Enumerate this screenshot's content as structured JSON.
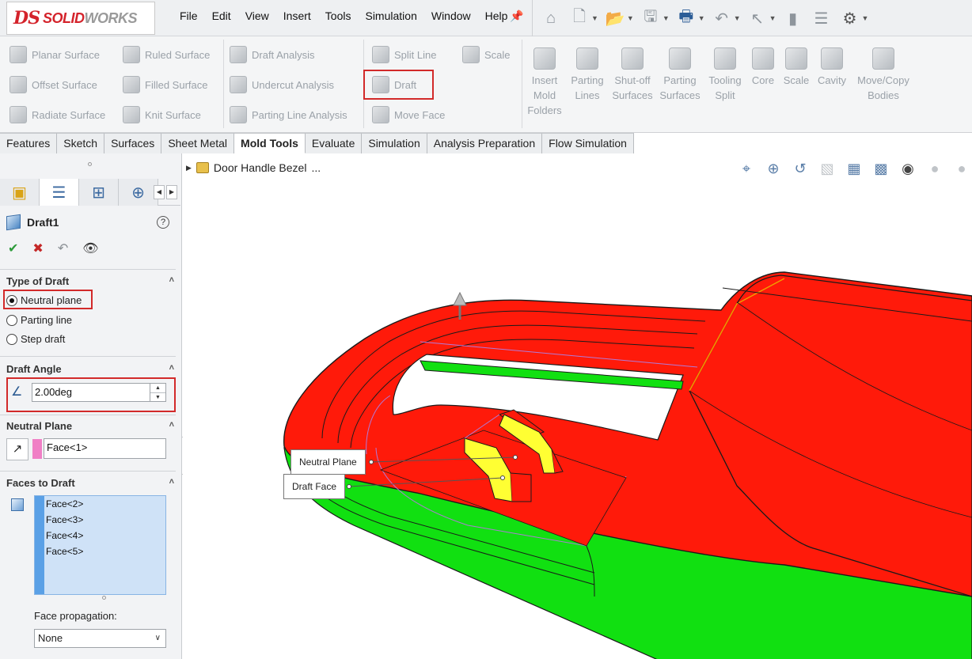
{
  "app": {
    "logo_mark": "DS",
    "logo_name_a": "SOLID",
    "logo_name_b": "WORKS",
    "menus": [
      "File",
      "Edit",
      "View",
      "Insert",
      "Tools",
      "Simulation",
      "Window",
      "Help"
    ]
  },
  "quick_icons": [
    "home-icon",
    "new-document-icon",
    "open-folder-icon",
    "save-icon",
    "print-icon",
    "undo-icon",
    "select-pointer-icon",
    "rebuild-icon",
    "file-properties-icon",
    "options-gear-icon"
  ],
  "ribbon": {
    "surfaces_col1": [
      "Planar Surface",
      "Offset Surface",
      "Radiate Surface"
    ],
    "surfaces_col2": [
      "Ruled Surface",
      "Filled Surface",
      "Knit Surface"
    ],
    "analysis": [
      "Draft Analysis",
      "Undercut Analysis",
      "Parting Line Analysis"
    ],
    "faces_col1": [
      "Split Line",
      "Draft",
      "Move Face"
    ],
    "scale": "Scale",
    "tooling": [
      [
        "Insert",
        "Mold",
        "Folders"
      ],
      [
        "Parting",
        "Lines"
      ],
      [
        "Shut-off",
        "Surfaces"
      ],
      [
        "Parting",
        "Surfaces"
      ],
      [
        "Tooling",
        "Split"
      ],
      [
        "Core"
      ],
      [
        "Scale"
      ],
      [
        "Cavity"
      ],
      [
        "Move/Copy",
        "Bodies"
      ]
    ]
  },
  "tabs": [
    "Features",
    "Sketch",
    "Surfaces",
    "Sheet Metal",
    "Mold Tools",
    "Evaluate",
    "Simulation",
    "Analysis Preparation",
    "Flow Simulation"
  ],
  "active_tab": "Mold Tools",
  "property_manager": {
    "title": "Draft1",
    "help": "?",
    "type_of_draft": {
      "heading": "Type of Draft",
      "options": [
        "Neutral plane",
        "Parting line",
        "Step draft"
      ],
      "selected": "Neutral plane"
    },
    "draft_angle": {
      "heading": "Draft Angle",
      "value": "2.00deg"
    },
    "neutral_plane": {
      "heading": "Neutral Plane",
      "value": "Face<1>",
      "color": "#f07fc5"
    },
    "faces_to_draft": {
      "heading": "Faces to Draft",
      "items": [
        "Face<2>",
        "Face<3>",
        "Face<4>",
        "Face<5>"
      ]
    },
    "face_propagation": {
      "label": "Face propagation:",
      "value": "None"
    }
  },
  "viewport": {
    "breadcrumb": "Door Handle Bezel",
    "breadcrumb_more": "...",
    "callouts": {
      "neutral_plane": "Neutral Plane",
      "draft_face": "Draft Face"
    },
    "colors": {
      "part": "#ff0000",
      "side": "#11e011",
      "draft_face": "#ffff33",
      "edge": "#1a1a1a"
    }
  }
}
